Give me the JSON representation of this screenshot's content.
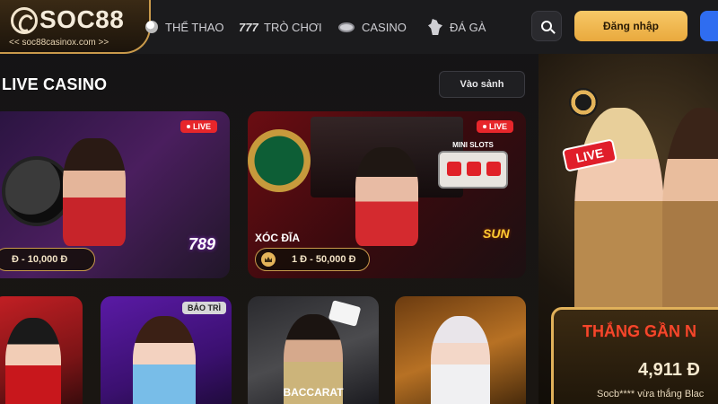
{
  "header": {
    "logo_text": "SOC88",
    "logo_subtitle": "<< soc88casinox.com >>",
    "nav": [
      {
        "label": "THỂ THAO",
        "icon": "soccer-ball-icon"
      },
      {
        "label": "TRÒ CHƠI",
        "icon": "slot-777-icon"
      },
      {
        "label": "CASINO",
        "icon": "casino-chip-icon"
      },
      {
        "label": "ĐÁ GÀ",
        "icon": "rooster-icon"
      }
    ],
    "search_icon": "search-icon",
    "login_label": "Đăng nhập",
    "accent_color": "#f2b84b",
    "register_color": "#2f6df0"
  },
  "section": {
    "title": "LIVE CASINO",
    "enter_label": "Vào sảnh"
  },
  "cards": [
    {
      "badge": "LIVE",
      "name": "",
      "bet_range": "Đ - 10,000 Đ",
      "provider": "789 CLUB"
    },
    {
      "badge": "LIVE",
      "name": "XÓC ĐĨA",
      "bet_range": "1 Đ - 50,000 Đ",
      "provider": "SUN",
      "mini_slots": "MINI SLOTS"
    }
  ],
  "bottom_cards": [
    {
      "badge": ""
    },
    {
      "badge": "BẢO TRÌ"
    },
    {
      "label": "BACCARAT"
    },
    {
      "badge": ""
    }
  ],
  "promo": {
    "live_sign": "LIVE",
    "win_title": "THẮNG GẦN N",
    "win_amount": "4,911 Đ",
    "win_text": "Socb**** vừa thắng Blac"
  }
}
